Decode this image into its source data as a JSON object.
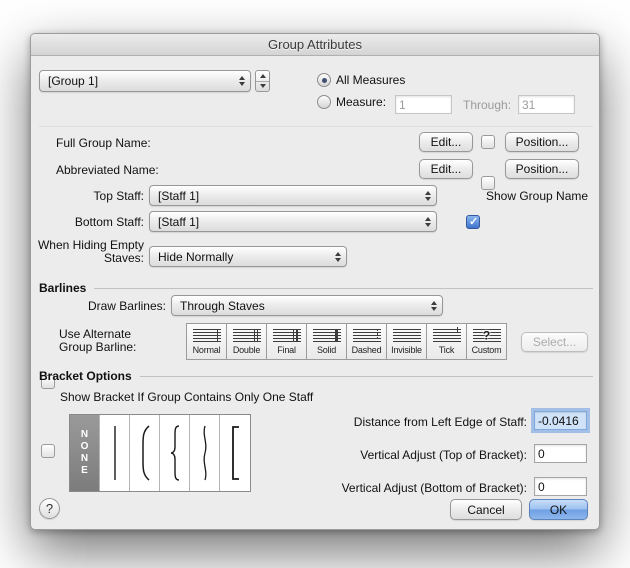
{
  "window": {
    "title": "Group Attributes"
  },
  "top": {
    "group_popup": "[Group 1]",
    "all_measures": "All Measures",
    "measure": "Measure:",
    "measure_start": "1",
    "through": "Through:",
    "measure_end": "31"
  },
  "names": {
    "full_label": "Full Group Name:",
    "abbr_label": "Abbreviated Name:",
    "edit": "Edit...",
    "position": "Position..."
  },
  "staff": {
    "top_label": "Top Staff:",
    "top_value": "[Staff 1]",
    "bottom_label": "Bottom Staff:",
    "bottom_value": "[Staff 1]",
    "show_group_name": "Show Group Name",
    "hiding_label_1": "When Hiding Empty",
    "hiding_label_2": "Staves:",
    "hiding_value": "Hide Normally"
  },
  "barlines": {
    "title": "Barlines",
    "draw_label": "Draw Barlines:",
    "draw_value": "Through Staves",
    "alt_label_1": "Use Alternate",
    "alt_label_2": "Group Barline:",
    "styles": [
      "Normal",
      "Double",
      "Final",
      "Solid",
      "Dashed",
      "Invisible",
      "Tick",
      "Custom"
    ],
    "custom_glyph": "?",
    "select": "Select..."
  },
  "bracket": {
    "title": "Bracket Options",
    "only_one_staff": "Show Bracket If Group Contains Only One Staff",
    "none": "NONE",
    "distance_label": "Distance from Left Edge of Staff:",
    "distance_value": "-0.0416",
    "vtop_label": "Vertical Adjust (Top of Bracket):",
    "vtop_value": "0",
    "vbottom_label": "Vertical Adjust (Bottom of Bracket):",
    "vbottom_value": "0"
  },
  "footer": {
    "help": "?",
    "cancel": "Cancel",
    "ok": "OK"
  }
}
